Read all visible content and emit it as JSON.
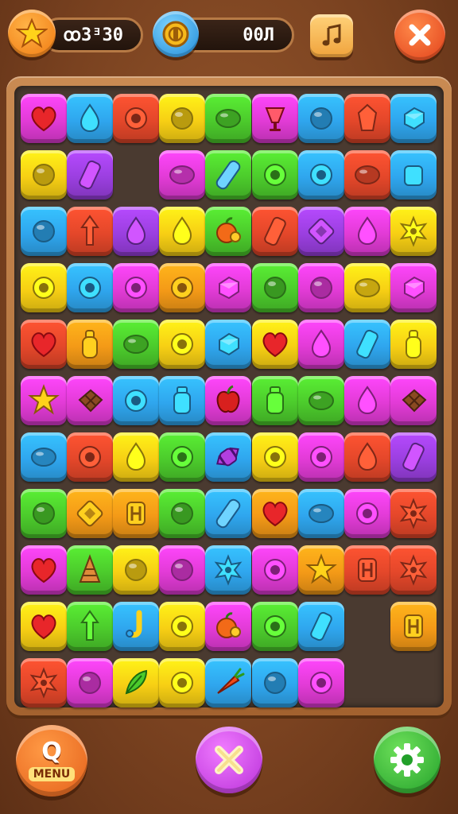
{
  "hud": {
    "score_text": "ꝏ3ᴲ30",
    "moves_text": "00Л",
    "star_icon": "star-icon",
    "coin_icon": "coin-icon",
    "music_icon": "music-note-icon",
    "close_icon": "close-icon"
  },
  "bottom": {
    "menu_glyph": "Q",
    "menu_label": "MENU",
    "shuffle_icon": "cross-icon",
    "settings_icon": "gear-icon"
  },
  "colors": {
    "pink": "#e23bd6",
    "blue": "#2fa6ee",
    "red": "#e4472a",
    "yellow": "#f7cf14",
    "green": "#4ccb2c",
    "purple": "#9b3fe0",
    "orange": "#f49a17"
  },
  "board": {
    "rows": [
      [
        {
          "c": "pink",
          "i": "heart"
        },
        {
          "c": "blue",
          "i": "drop"
        },
        {
          "c": "red",
          "i": "ring"
        },
        {
          "c": "yellow",
          "i": "circle"
        },
        {
          "c": "green",
          "i": "oval"
        },
        {
          "c": "pink",
          "i": "cup"
        },
        {
          "c": "blue",
          "i": "circle"
        },
        {
          "c": "red",
          "i": "gem"
        },
        {
          "c": "blue",
          "i": "cube"
        }
      ],
      [
        {
          "c": "yellow",
          "i": "circle"
        },
        {
          "c": "purple",
          "i": "bar"
        },
        null,
        {
          "c": "pink",
          "i": "oval"
        },
        {
          "c": "green",
          "i": "tube"
        },
        {
          "c": "green",
          "i": "ring"
        },
        {
          "c": "blue",
          "i": "ring"
        },
        {
          "c": "red",
          "i": "oval"
        },
        {
          "c": "blue",
          "i": "square"
        }
      ],
      [
        {
          "c": "blue",
          "i": "circle"
        },
        {
          "c": "red",
          "i": "arrow"
        },
        {
          "c": "purple",
          "i": "drop"
        },
        {
          "c": "yellow",
          "i": "drop"
        },
        {
          "c": "green",
          "i": "fruit"
        },
        {
          "c": "red",
          "i": "bar"
        },
        {
          "c": "purple",
          "i": "box"
        },
        {
          "c": "pink",
          "i": "drop"
        },
        {
          "c": "yellow",
          "i": "splat"
        }
      ],
      [
        {
          "c": "yellow",
          "i": "ring"
        },
        {
          "c": "blue",
          "i": "ring"
        },
        {
          "c": "pink",
          "i": "ring"
        },
        {
          "c": "orange",
          "i": "ring"
        },
        {
          "c": "pink",
          "i": "cube"
        },
        {
          "c": "green",
          "i": "circle"
        },
        {
          "c": "pink",
          "i": "circle"
        },
        {
          "c": "yellow",
          "i": "oval"
        },
        {
          "c": "pink",
          "i": "cube"
        }
      ],
      [
        {
          "c": "red",
          "i": "heart"
        },
        {
          "c": "orange",
          "i": "bottle"
        },
        {
          "c": "green",
          "i": "oval"
        },
        {
          "c": "yellow",
          "i": "ring"
        },
        {
          "c": "blue",
          "i": "cube"
        },
        {
          "c": "yellow",
          "i": "heart"
        },
        {
          "c": "pink",
          "i": "drop"
        },
        {
          "c": "blue",
          "i": "bar"
        },
        {
          "c": "yellow",
          "i": "bottle"
        }
      ],
      [
        {
          "c": "pink",
          "i": "star"
        },
        {
          "c": "pink",
          "i": "choco"
        },
        {
          "c": "blue",
          "i": "ring"
        },
        {
          "c": "blue",
          "i": "jar"
        },
        {
          "c": "pink",
          "i": "apple"
        },
        {
          "c": "green",
          "i": "jar"
        },
        {
          "c": "green",
          "i": "oval"
        },
        {
          "c": "pink",
          "i": "drop"
        },
        {
          "c": "pink",
          "i": "choco"
        }
      ],
      [
        {
          "c": "blue",
          "i": "oval"
        },
        {
          "c": "red",
          "i": "ring"
        },
        {
          "c": "yellow",
          "i": "drop"
        },
        {
          "c": "green",
          "i": "ring"
        },
        {
          "c": "blue",
          "i": "candy"
        },
        {
          "c": "yellow",
          "i": "ring"
        },
        {
          "c": "pink",
          "i": "ring"
        },
        {
          "c": "red",
          "i": "drop"
        },
        {
          "c": "purple",
          "i": "bar"
        }
      ],
      [
        {
          "c": "green",
          "i": "circle"
        },
        {
          "c": "orange",
          "i": "box"
        },
        {
          "c": "orange",
          "i": "rune"
        },
        {
          "c": "green",
          "i": "circle"
        },
        {
          "c": "blue",
          "i": "tube"
        },
        {
          "c": "orange",
          "i": "heart"
        },
        {
          "c": "blue",
          "i": "oval"
        },
        {
          "c": "pink",
          "i": "ring"
        },
        {
          "c": "red",
          "i": "splat"
        }
      ],
      [
        {
          "c": "pink",
          "i": "heart"
        },
        {
          "c": "green",
          "i": "cone"
        },
        {
          "c": "yellow",
          "i": "circle"
        },
        {
          "c": "pink",
          "i": "circle"
        },
        {
          "c": "blue",
          "i": "splat"
        },
        {
          "c": "pink",
          "i": "ring"
        },
        {
          "c": "orange",
          "i": "star"
        },
        {
          "c": "red",
          "i": "rune"
        },
        {
          "c": "red",
          "i": "splat"
        }
      ],
      [
        {
          "c": "yellow",
          "i": "heart"
        },
        {
          "c": "green",
          "i": "arrow"
        },
        {
          "c": "blue",
          "i": "hook"
        },
        {
          "c": "yellow",
          "i": "ring"
        },
        {
          "c": "pink",
          "i": "fruit"
        },
        {
          "c": "green",
          "i": "ring"
        },
        {
          "c": "blue",
          "i": "bar"
        },
        null,
        {
          "c": "orange",
          "i": "rune"
        }
      ],
      [
        {
          "c": "red",
          "i": "splat"
        },
        {
          "c": "pink",
          "i": "circle"
        },
        {
          "c": "yellow",
          "i": "leaf"
        },
        {
          "c": "yellow",
          "i": "ring"
        },
        {
          "c": "blue",
          "i": "carrot"
        },
        {
          "c": "blue",
          "i": "circle"
        },
        {
          "c": "pink",
          "i": "ring"
        },
        null,
        null
      ]
    ]
  }
}
